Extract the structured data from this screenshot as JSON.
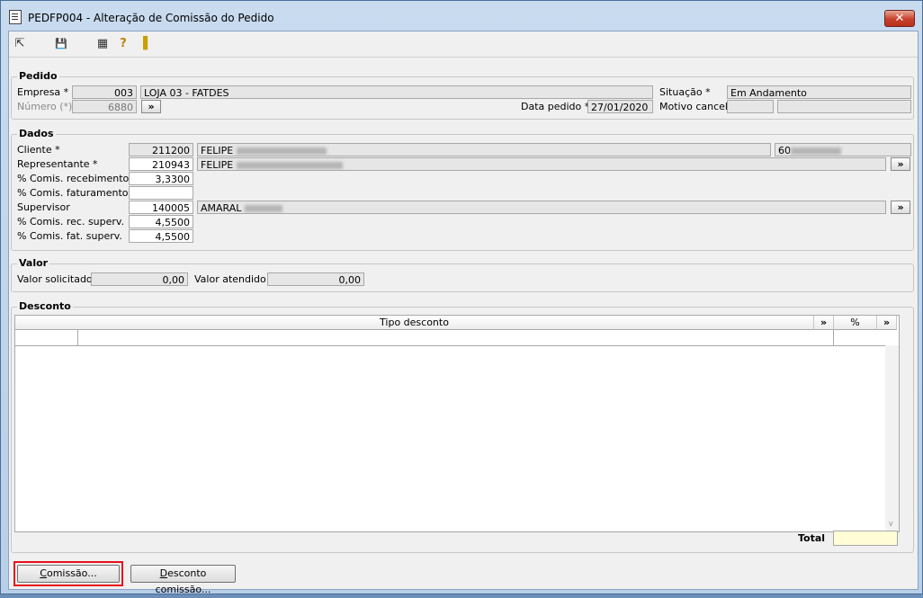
{
  "window": {
    "title": "PEDFP004 - Alteração de Comissão do Pedido",
    "close_label": "✕"
  },
  "toolbar": {
    "items": [
      {
        "name": "back-icon",
        "glyph": "⇱"
      },
      {
        "name": "save-icon",
        "glyph": "💾"
      },
      {
        "name": "calendar-icon",
        "glyph": "▦"
      },
      {
        "name": "help-icon",
        "glyph": "?"
      },
      {
        "name": "exit-door-icon",
        "glyph": "▐"
      }
    ]
  },
  "pedido": {
    "legend": "Pedido",
    "empresa_label": "Empresa *",
    "empresa_code": "003",
    "empresa_name": "LOJA 03 - FATDES",
    "numero_label": "Número (*)",
    "numero_value": "6880",
    "numero_btn": "»",
    "data_label": "Data pedido *",
    "data_value": "27/01/2020",
    "situacao_label": "Situação *",
    "situacao_value": "Em Andamento",
    "motivo_label": "Motivo cancel.",
    "motivo_code": "",
    "motivo_desc": ""
  },
  "dados": {
    "legend": "Dados",
    "cliente_label": "Cliente *",
    "cliente_code": "211200",
    "cliente_name": "FELIPE",
    "cliente_doc": "60",
    "representante_label": "Representante *",
    "representante_code": "210943",
    "representante_name": "FELIPE",
    "representante_btn": "»",
    "comis_receb_label": "% Comis. recebimento",
    "comis_receb_value": "3,3300",
    "comis_fat_label": "% Comis. faturamento",
    "comis_fat_value": "",
    "supervisor_label": "Supervisor",
    "supervisor_code": "140005",
    "supervisor_name": "AMARAL",
    "supervisor_btn": "»",
    "comis_rec_superv_label": "% Comis. rec. superv.",
    "comis_rec_superv_value": "4,5500",
    "comis_fat_superv_label": "% Comis. fat. superv.",
    "comis_fat_superv_value": "4,5500"
  },
  "valor": {
    "legend": "Valor",
    "solicitado_label": "Valor solicitado",
    "solicitado_value": "0,00",
    "atendido_label": "Valor atendido",
    "atendido_value": "0,00"
  },
  "desconto": {
    "legend": "Desconto",
    "col_tipo": "Tipo desconto",
    "col_tipo_btn": "»",
    "col_pct": "%",
    "col_pct_btn": "»",
    "total_label": "Total",
    "total_value": ""
  },
  "buttons": {
    "comissao_u": "C",
    "comissao_rest": "omissão...",
    "desconto_u": "D",
    "desconto_rest": "esconto comissão..."
  },
  "colors": {
    "highlight": "#e8101b",
    "close": "#c8412c"
  }
}
